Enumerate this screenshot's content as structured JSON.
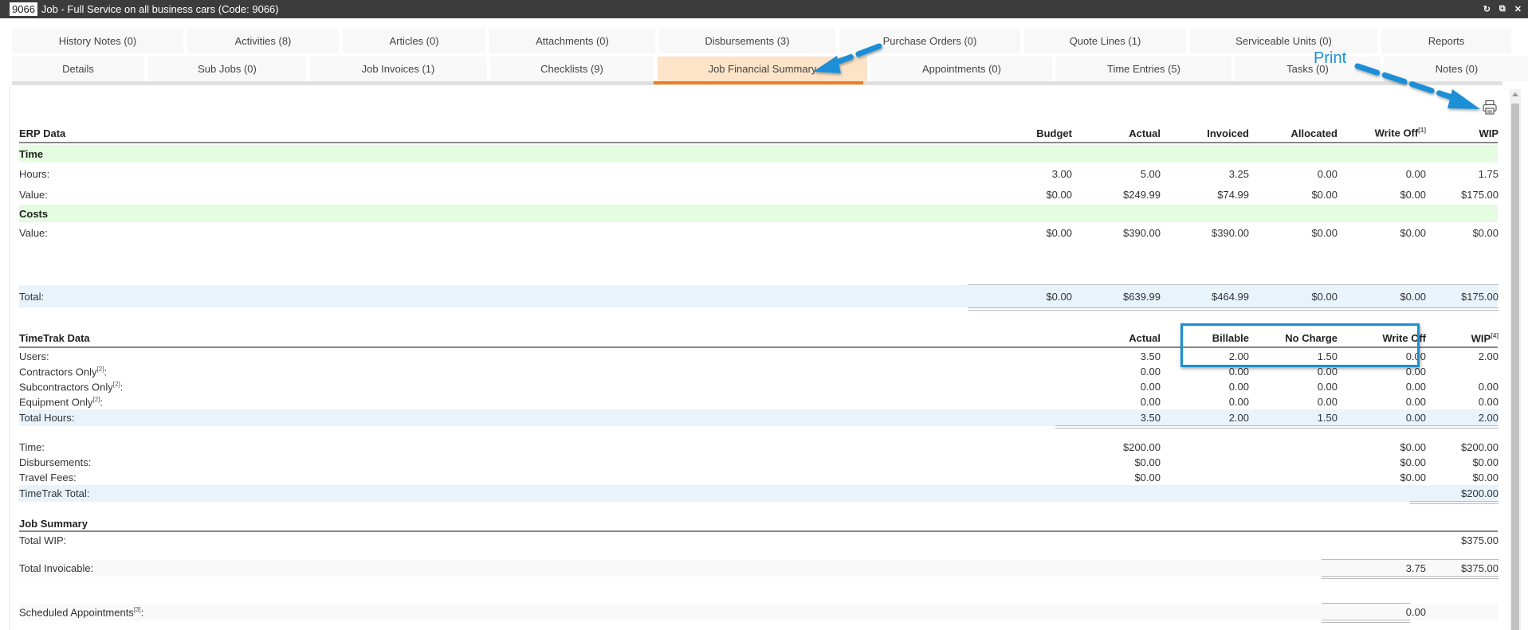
{
  "window": {
    "code_badge": "9066",
    "title": "Job - Full Service on all business cars (Code: 9066)",
    "controls": [
      "refresh-icon",
      "restore-icon",
      "close-icon"
    ],
    "controls_glyphs": [
      "↻",
      "⧉",
      "✕"
    ]
  },
  "tabs_row1": [
    {
      "label": "History Notes (0)"
    },
    {
      "label": "Activities (8)"
    },
    {
      "label": "Articles (0)"
    },
    {
      "label": "Attachments (0)"
    },
    {
      "label": "Disbursements (3)"
    },
    {
      "label": "Purchase Orders (0)"
    },
    {
      "label": "Quote Lines (1)"
    },
    {
      "label": "Serviceable Units (0)"
    },
    {
      "label": "Reports"
    }
  ],
  "tabs_row2": [
    {
      "label": "Details"
    },
    {
      "label": "Sub Jobs (0)"
    },
    {
      "label": "Job Invoices (1)"
    },
    {
      "label": "Checklists (9)"
    },
    {
      "label": "Job Financial Summary",
      "active": true
    },
    {
      "label": "Appointments (0)"
    },
    {
      "label": "Time Entries (5)"
    },
    {
      "label": "Tasks (0)"
    },
    {
      "label": "Notes (0)"
    }
  ],
  "annotation": {
    "print_label": "Print",
    "color": "#1b8fd6"
  },
  "accent": {
    "active_tab_bg": "#fde3c8",
    "active_tab_underline": "#f07f1f"
  },
  "erp": {
    "title": "ERP Data",
    "columns": [
      "Budget",
      "Actual",
      "Invoiced",
      "Allocated",
      "Write Off",
      "WIP"
    ],
    "writeoff_sup": "[1]",
    "time_header": "Time",
    "hours_label": "Hours:",
    "hours": [
      "3.00",
      "5.00",
      "3.25",
      "0.00",
      "0.00",
      "1.75"
    ],
    "time_value_label": "Value:",
    "time_value": [
      "$0.00",
      "$249.99",
      "$74.99",
      "$0.00",
      "$0.00",
      "$175.00"
    ],
    "costs_header": "Costs",
    "costs_value_label": "Value:",
    "costs_value": [
      "$0.00",
      "$390.00",
      "$390.00",
      "$0.00",
      "$0.00",
      "$0.00"
    ],
    "total_label": "Total:",
    "total": [
      "$0.00",
      "$639.99",
      "$464.99",
      "$0.00",
      "$0.00",
      "$175.00"
    ]
  },
  "timetrak": {
    "title": "TimeTrak Data",
    "columns": [
      "Actual",
      "Billable",
      "No Charge",
      "Write Off",
      "WIP"
    ],
    "wip_sup": "[4]",
    "rows": [
      {
        "label": "Users:",
        "sup": "",
        "values": [
          "3.50",
          "2.00",
          "1.50",
          "0.00",
          "2.00"
        ]
      },
      {
        "label": "Contractors Only",
        "sup": "[2]",
        "values": [
          "0.00",
          "0.00",
          "0.00",
          "0.00",
          ""
        ]
      },
      {
        "label": "Subcontractors Only",
        "sup": "[2]",
        "values": [
          "0.00",
          "0.00",
          "0.00",
          "0.00",
          "0.00"
        ]
      },
      {
        "label": "Equipment Only",
        "sup": "[2]",
        "values": [
          "0.00",
          "0.00",
          "0.00",
          "0.00",
          "0.00"
        ]
      }
    ],
    "total_hours_label": "Total Hours:",
    "total_hours": [
      "3.50",
      "2.00",
      "1.50",
      "0.00",
      "2.00"
    ],
    "money_rows": [
      {
        "label": "Time:",
        "actual": "$200.00",
        "writeoff": "$0.00",
        "wip": "$200.00"
      },
      {
        "label": "Disbursements:",
        "actual": "$0.00",
        "writeoff": "$0.00",
        "wip": "$0.00"
      },
      {
        "label": "Travel Fees:",
        "actual": "$0.00",
        "writeoff": "$0.00",
        "wip": "$0.00"
      }
    ],
    "total_label": "TimeTrak Total:",
    "total_wip": "$200.00"
  },
  "summary": {
    "title": "Job Summary",
    "total_wip_label": "Total WIP:",
    "total_wip": "$375.00",
    "total_invoicable_label": "Total Invoicable:",
    "total_invoicable_hours": "3.75",
    "total_invoicable_value": "$375.00",
    "scheduled_label": "Scheduled Appointments",
    "scheduled_sup": "[3]",
    "scheduled_value": "0.00"
  }
}
